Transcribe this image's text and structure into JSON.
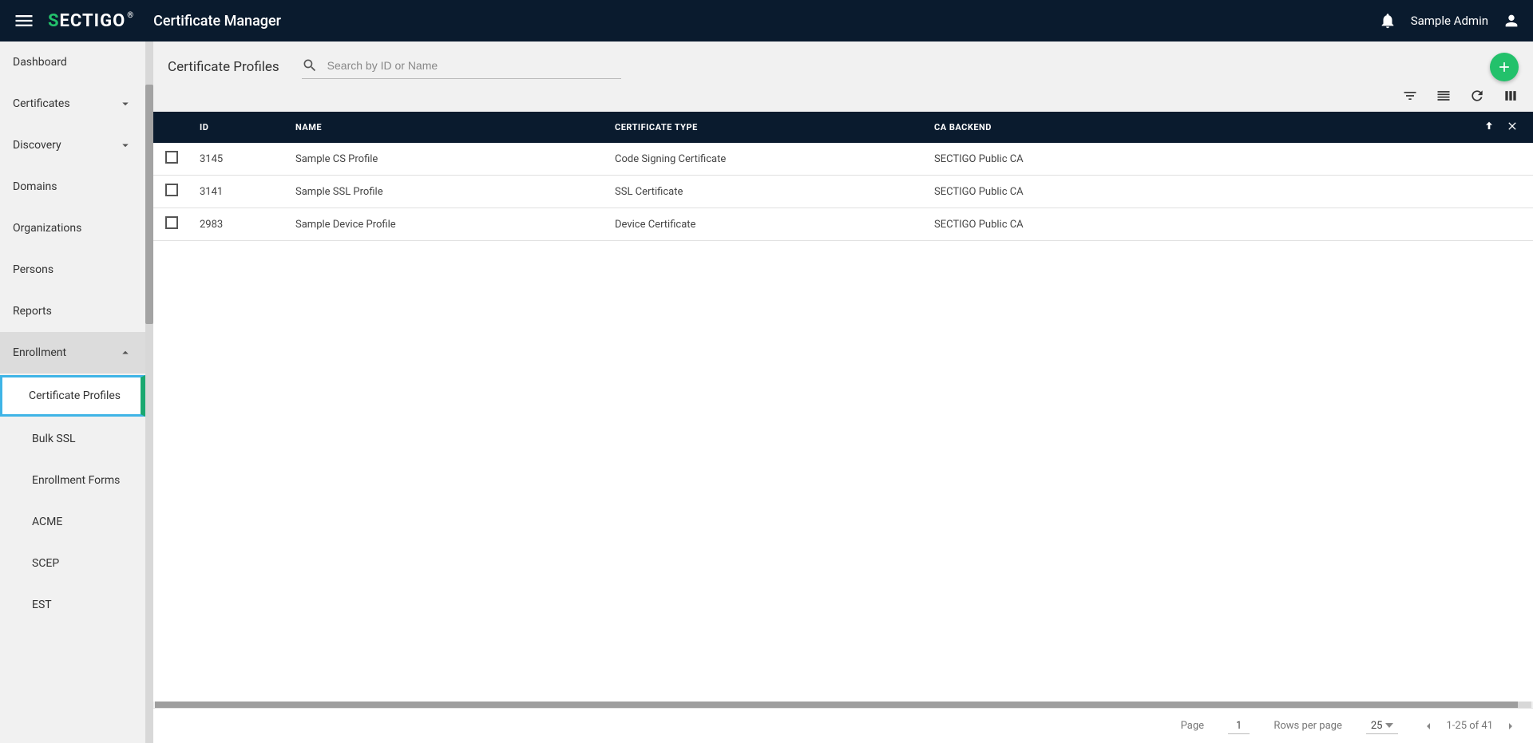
{
  "header": {
    "logo_text_prefix": "S",
    "logo_text_rest": "ECTIGO",
    "logo_reg": "®",
    "app_title": "Certificate Manager",
    "user_name": "Sample Admin"
  },
  "sidebar": {
    "items": [
      {
        "label": "Dashboard",
        "type": "link"
      },
      {
        "label": "Certificates",
        "type": "expand",
        "expanded": false
      },
      {
        "label": "Discovery",
        "type": "expand",
        "expanded": false
      },
      {
        "label": "Domains",
        "type": "link"
      },
      {
        "label": "Organizations",
        "type": "link"
      },
      {
        "label": "Persons",
        "type": "link"
      },
      {
        "label": "Reports",
        "type": "link"
      },
      {
        "label": "Enrollment",
        "type": "expand",
        "expanded": true,
        "children": [
          {
            "label": "Certificate Profiles",
            "active": true
          },
          {
            "label": "Bulk SSL"
          },
          {
            "label": "Enrollment Forms"
          },
          {
            "label": "ACME"
          },
          {
            "label": "SCEP"
          },
          {
            "label": "EST"
          }
        ]
      }
    ]
  },
  "page": {
    "title": "Certificate Profiles",
    "search_placeholder": "Search by ID or Name"
  },
  "table": {
    "columns": {
      "id": "ID",
      "name": "NAME",
      "type": "CERTIFICATE TYPE",
      "ca": "CA BACKEND"
    },
    "rows": [
      {
        "id": "3145",
        "name": "Sample CS Profile",
        "type": "Code Signing Certificate",
        "ca": "SECTIGO Public CA"
      },
      {
        "id": "3141",
        "name": "Sample SSL Profile",
        "type": "SSL Certificate",
        "ca": "SECTIGO Public CA"
      },
      {
        "id": "2983",
        "name": "Sample Device Profile",
        "type": "Device Certificate",
        "ca": "SECTIGO Public CA"
      }
    ]
  },
  "footer": {
    "page_label": "Page",
    "page_number": "1",
    "rows_per_page_label": "Rows per page",
    "rows_per_page_value": "25",
    "range": "1-25 of 41"
  }
}
